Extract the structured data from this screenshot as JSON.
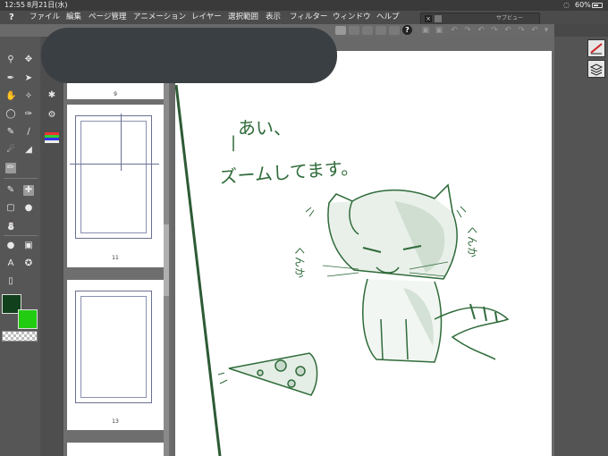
{
  "status": {
    "time": "12:55",
    "date": "8月21日(水)",
    "battery": "60%"
  },
  "menu": {
    "items": [
      "ファイル",
      "編集",
      "ページ管理",
      "アニメーション",
      "レイヤー",
      "選択範囲",
      "表示",
      "フィルター",
      "ウィンドウ",
      "ヘルプ"
    ]
  },
  "subview": {
    "title": "サブビュー"
  },
  "toolbar": {
    "help_label": "?"
  },
  "pages": [
    {
      "number": "9"
    },
    {
      "number": "11"
    },
    {
      "number": "13"
    }
  ],
  "colors": {
    "main": "#10401c",
    "sub": "#22cc11",
    "ink": "#2f6b3a"
  },
  "drawing": {
    "line1": "あい、",
    "line2": "ズームしてます。",
    "left_note": "くんか",
    "right_note": "くんか"
  }
}
